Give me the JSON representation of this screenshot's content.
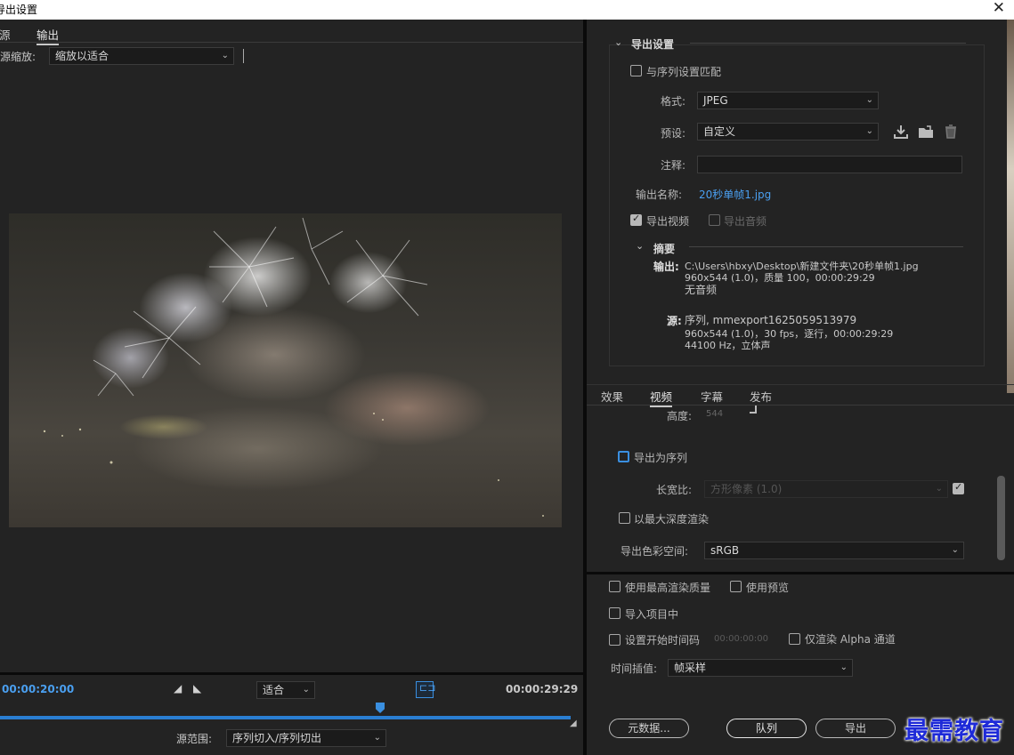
{
  "window": {
    "title": "导出设置",
    "close_glyph": "✕"
  },
  "left": {
    "tabs": [
      "源",
      "输出"
    ],
    "source_scale_label": "源缩放:",
    "source_scale_value": "缩放以适合",
    "timeline": {
      "current_time": "00:00:20:00",
      "fit_value": "适合",
      "end_time": "00:00:29:29",
      "source_range_label": "源范围:",
      "source_range_value": "序列切入/序列切出"
    }
  },
  "export_settings": {
    "header": "导出设置",
    "match_sequence_label": "与序列设置匹配",
    "format_label": "格式:",
    "format_value": "JPEG",
    "preset_label": "预设:",
    "preset_value": "自定义",
    "comments_label": "注释:",
    "comments_value": "",
    "output_name_label": "输出名称:",
    "output_name_value": "20秒单帧1.jpg",
    "export_video_label": "导出视频",
    "export_audio_label": "导出音频",
    "summary": {
      "header": "摘要",
      "output_label": "输出:",
      "output_line1": "C:\\Users\\hbxy\\Desktop\\新建文件夹\\20秒单帧1.jpg",
      "output_line2": "960x544 (1.0)，质量 100，00:00:29:29",
      "output_line3": "无音频",
      "source_label": "源:",
      "source_line1": "序列, mmexport1625059513979",
      "source_line2": "960x544 (1.0)，30 fps，逐行，00:00:29:29",
      "source_line3": "44100 Hz，立体声"
    }
  },
  "right_tabs": [
    "效果",
    "视频",
    "字幕",
    "发布"
  ],
  "video": {
    "height_label": "高度:",
    "height_value": "544",
    "export_as_sequence_label": "导出为序列",
    "aspect_label": "长宽比:",
    "aspect_value": "方形像素 (1.0)",
    "max_depth_label": "以最大深度渲染",
    "color_space_label": "导出色彩空间:",
    "color_space_value": "sRGB"
  },
  "bottom": {
    "max_render_quality_label": "使用最高渲染质量",
    "use_previews_label": "使用预览",
    "import_into_project_label": "导入项目中",
    "set_start_timecode_label": "设置开始时间码",
    "start_timecode_value": "00:00:00:00",
    "render_alpha_label": "仅渲染 Alpha 通道",
    "time_interpolation_label": "时间插值:",
    "time_interpolation_value": "帧采样",
    "metadata_button": "元数据...",
    "queue_button": "队列",
    "export_button": "导出"
  },
  "watermark": "最需教育",
  "colors": {
    "accent": "#3a8fe0",
    "background": "#232323",
    "watermark": "#1e2ad8"
  }
}
